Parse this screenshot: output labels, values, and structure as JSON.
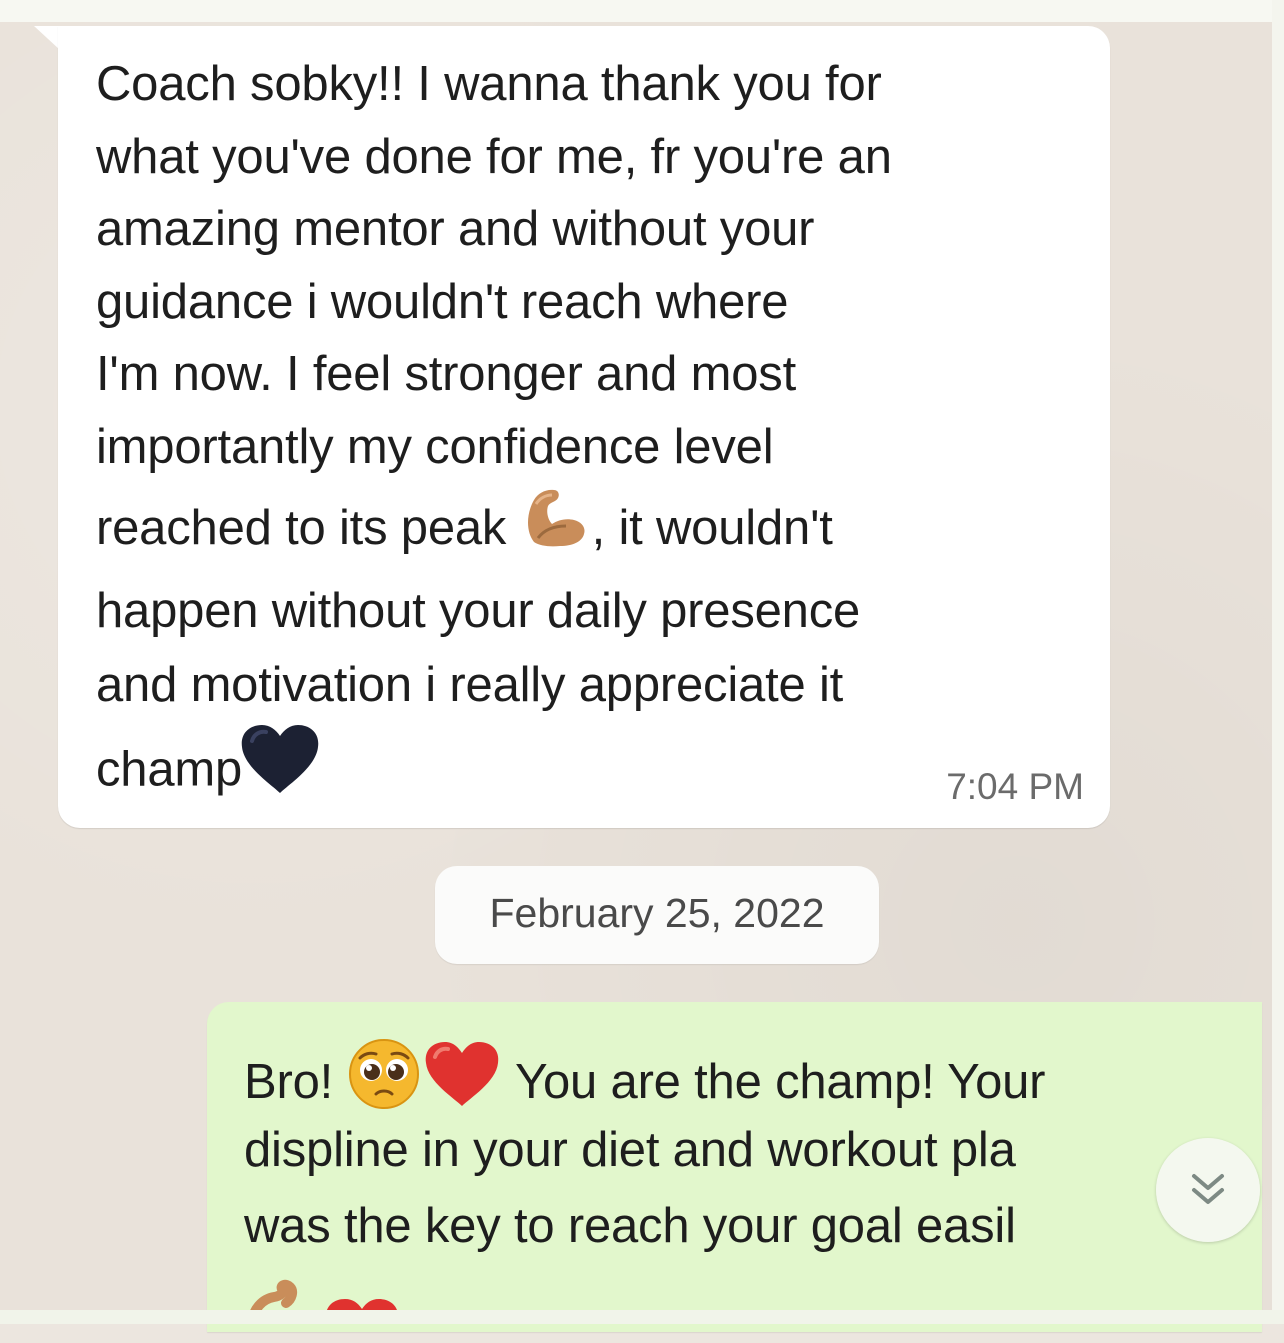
{
  "conversation": {
    "incoming": {
      "lines": [
        "Coach sobky!! I wanna thank you for",
        "what you've done for me, fr you're an",
        "amazing mentor and without your",
        "guidance i wouldn't reach where",
        "I'm now. I feel stronger and most",
        "importantly my confidence level"
      ],
      "line7_before": "reached to its peak ",
      "line7_after": ", it wouldn't",
      "line8": "happen without your daily presence",
      "line9": "and motivation i really appreciate it",
      "line10": "champ",
      "time": "7:04 PM",
      "emoji_flexed": "flexed-biceps-icon",
      "emoji_heart": "black-heart-icon"
    },
    "date_separator": "February 25, 2022",
    "outgoing": {
      "line1_before": "Bro! ",
      "line1_after": " You are the champ! Your",
      "line2": "displine in your diet and workout pla",
      "line3": "was the key to reach your goal easil",
      "emoji_pleading": "pleading-face-icon",
      "emoji_heart": "red-heart-icon"
    }
  },
  "controls": {
    "scroll_down_icon": "double-chevron-down-icon"
  },
  "colors": {
    "incoming_bubble": "#ffffff",
    "outgoing_bubble": "#e2f7cc",
    "chat_background": "#e9e2da",
    "timestamp": "#6b6b6b",
    "black_heart": "#1c2133",
    "red_heart": "#e0322f"
  }
}
